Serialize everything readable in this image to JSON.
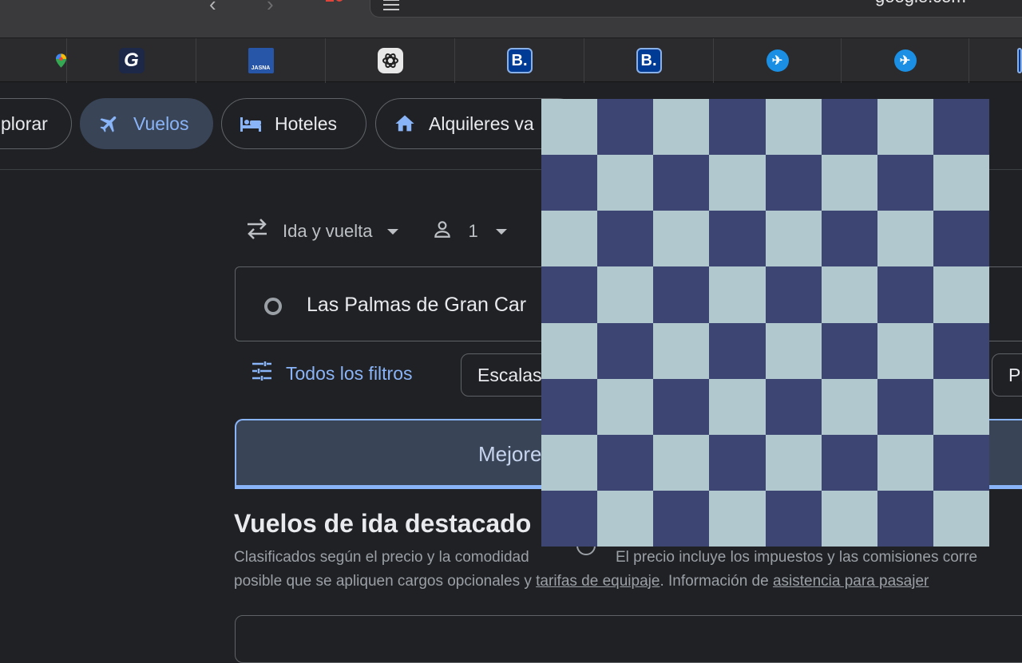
{
  "browser": {
    "url_text": "google.com",
    "bookmarks": [
      {
        "name": "google-maps",
        "text": ""
      },
      {
        "name": "grammarly",
        "text": "G"
      },
      {
        "name": "jasna",
        "text": "JASNA"
      },
      {
        "name": "chatgpt",
        "text": ""
      },
      {
        "name": "booking-1",
        "text": "B."
      },
      {
        "name": "booking-2",
        "text": "B."
      },
      {
        "name": "flights-1",
        "text": ""
      },
      {
        "name": "flights-2",
        "text": ""
      }
    ]
  },
  "tabs": [
    {
      "label": "plorar"
    },
    {
      "label": "Vuelos"
    },
    {
      "label": "Hoteles"
    },
    {
      "label": "Alquileres va"
    }
  ],
  "search": {
    "trip_type": "Ida y vuelta",
    "passengers": "1",
    "origin": "Las Palmas de Gran Car",
    "all_filters": "Todos los filtros",
    "stops_chip": "Escalas",
    "price_chip": "Pr"
  },
  "results": {
    "best_tab": "Mejore",
    "heading": "Vuelos de ida destacado",
    "sub_ranked": "Clasificados según el precio y la comodidad",
    "sub_price": "El precio incluye los impuestos y las comisiones corre",
    "sub_line2_start": "posible que se apliquen cargos opcionales y ",
    "link_baggage": "tarifas de equipaje",
    "sub_line2_mid": ". Información de ",
    "link_assist": "asistencia para pasajer"
  },
  "colors": {
    "checker_dark": "#3d4672",
    "checker_light": "#b1c8cf",
    "accent": "#8ab4f8"
  }
}
